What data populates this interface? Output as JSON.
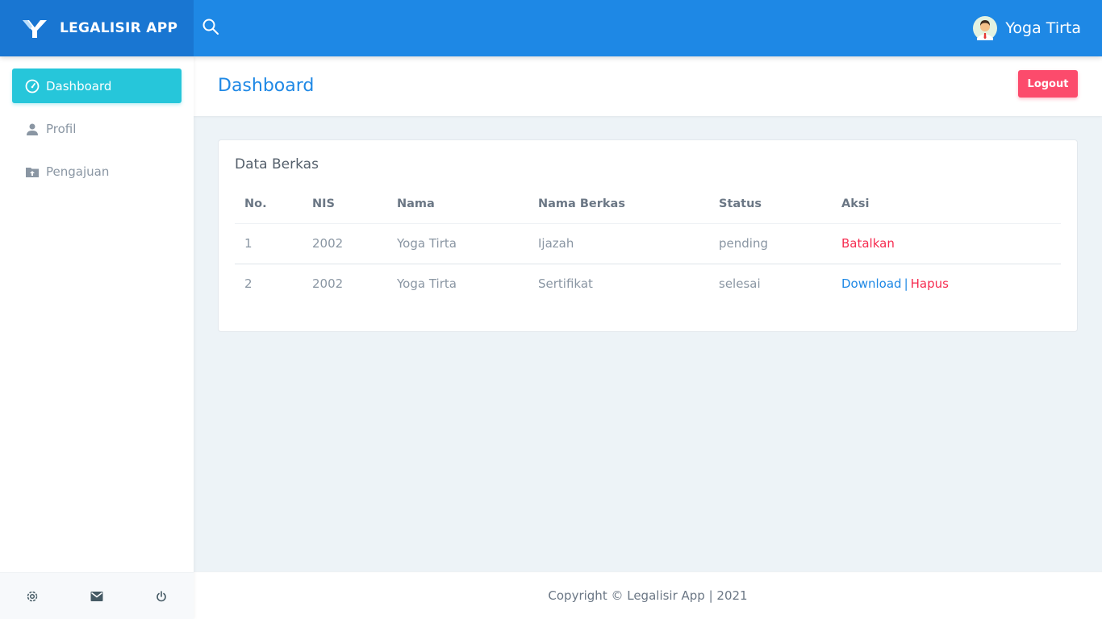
{
  "brand": {
    "name": "LEGALISIR APP",
    "logo_icon": "y-logo-icon"
  },
  "header": {
    "search_icon": "search-icon",
    "user_name": "Yoga Tirta",
    "avatar_icon": "user-avatar-icon"
  },
  "sidebar": {
    "items": [
      {
        "label": "Dashboard",
        "icon": "dashboard-gauge-icon",
        "active": true
      },
      {
        "label": "Profil",
        "icon": "person-icon",
        "active": false
      },
      {
        "label": "Pengajuan",
        "icon": "folder-upload-icon",
        "active": false
      }
    ],
    "footer_icons": [
      "gear-icon",
      "mail-icon",
      "power-icon"
    ]
  },
  "page": {
    "title": "Dashboard",
    "logout_label": "Logout"
  },
  "card": {
    "title": "Data Berkas",
    "columns": [
      "No.",
      "NIS",
      "Nama",
      "Nama Berkas",
      "Status",
      "Aksi"
    ],
    "rows": [
      {
        "no": "1",
        "nis": "2002",
        "nama": "Yoga Tirta",
        "berkas": "Ijazah",
        "status": "pending",
        "actions": [
          "Batalkan"
        ]
      },
      {
        "no": "2",
        "nis": "2002",
        "nama": "Yoga Tirta",
        "berkas": "Sertifikat",
        "status": "selesai",
        "actions": [
          "Download",
          "|",
          "Hapus"
        ]
      }
    ]
  },
  "footer": {
    "copyright": "Copyright © Legalisir App | 2021"
  },
  "colors": {
    "topbar": "#1e88e5",
    "brand_bg": "#1976d2",
    "active_nav": "#26c6da",
    "logout": "#fc4b6c",
    "link_red": "#f62d51",
    "link_blue": "#1e88e5"
  }
}
